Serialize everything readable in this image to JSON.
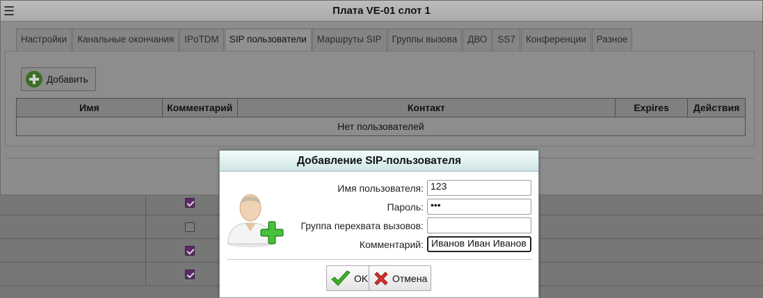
{
  "window": {
    "title": "Плата VE-01 слот 1",
    "menu_icon": "hamburger-icon"
  },
  "tabs": [
    {
      "label": "Настройки"
    },
    {
      "label": "Канальные окончания"
    },
    {
      "label": "IPoTDM"
    },
    {
      "label": "SIP пользователи",
      "active": true
    },
    {
      "label": "Маршруты SIP"
    },
    {
      "label": "Группы вызова"
    },
    {
      "label": "ДВО"
    },
    {
      "label": "SS7"
    },
    {
      "label": "Конференции"
    },
    {
      "label": "Разное"
    }
  ],
  "toolbar": {
    "add_label": "Добавить",
    "add_icon": "plus-circle-icon"
  },
  "users_table": {
    "columns": [
      "Имя",
      "Комментарий",
      "Контакт",
      "Expires",
      "Действия"
    ],
    "empty_text": "Нет пользователей"
  },
  "background_rows": [
    {
      "checked": true
    },
    {
      "checked": false
    },
    {
      "checked": true
    },
    {
      "checked": true
    }
  ],
  "dialog": {
    "title": "Добавление SIP-пользователя",
    "icon": "add-user-icon",
    "fields": [
      {
        "label": "Имя пользователя:",
        "value": "123"
      },
      {
        "label": "Пароль:",
        "value": "•••"
      },
      {
        "label": "Группа перехвата вызовов:",
        "value": ""
      },
      {
        "label": "Комментарий:",
        "value": "Иванов Иван Иванов"
      }
    ],
    "ok_label": "OK",
    "cancel_label": "Отмена"
  },
  "colors": {
    "dialog_title_bg": "#d9eeee",
    "ok_check": "#3fae2a",
    "cancel_cross": "#d0312d",
    "checkbox_checked": "#5a2a66"
  }
}
